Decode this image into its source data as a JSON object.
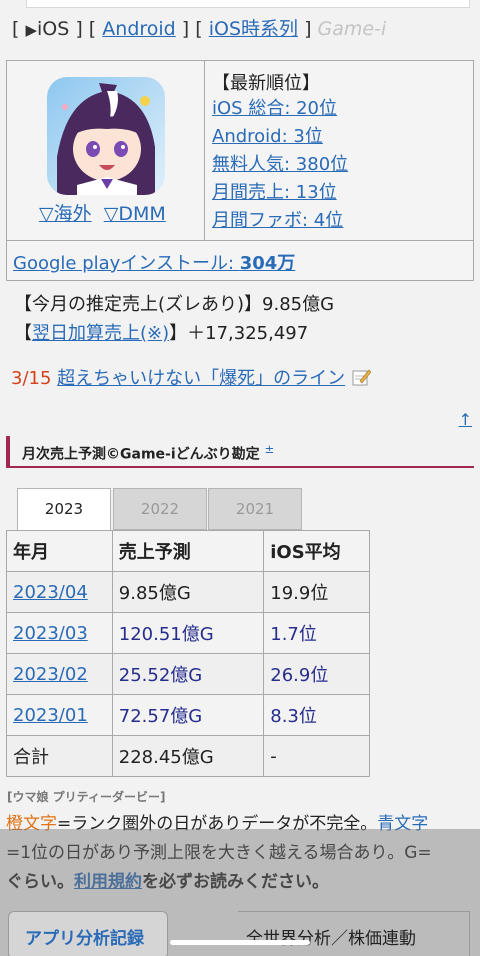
{
  "nav": {
    "open_bracket": "[",
    "ios_label": "iOS",
    "sep1": "] [",
    "android_label": "Android",
    "sep2": "] [",
    "timeline_label": "iOS時系列",
    "close_bracket": "]",
    "site_label": "Game-i"
  },
  "app": {
    "region_overseas": "▽海外",
    "region_dmm": "▽DMM",
    "ranking_title": "【最新順位】",
    "rankings": [
      "iOS 総合: 20位",
      "Android: 3位",
      "無料人気: 380位",
      "月間売上: 13位",
      "月間ファボ: 4位"
    ],
    "install_prefix": "Google playインストール: ",
    "install_count": "304万"
  },
  "estimates": {
    "monthly_label": "【今月の推定売上(ズレあり)】9.85億G",
    "daily_open": "【",
    "daily_link": "翌日加算売上(※)",
    "daily_close": "】＋17,325,497"
  },
  "warning": {
    "date": "3/15",
    "text": "超えちゃいけない「爆死」のライン",
    "icon": "memo-icon"
  },
  "section": {
    "title": "月次売上予測©Game-iどんぶり勘定",
    "sup": "±",
    "up_arrow": "↑"
  },
  "tabs": [
    "2023",
    "2022",
    "2021"
  ],
  "table": {
    "headers": [
      "年月",
      "売上予測",
      "iOS平均"
    ],
    "rows": [
      {
        "month": "2023/04",
        "sales": "9.85億G",
        "avg": "19.9位"
      },
      {
        "month": "2023/03",
        "sales": "120.51億G",
        "avg": "1.7位"
      },
      {
        "month": "2023/02",
        "sales": "25.52億G",
        "avg": "26.9位"
      },
      {
        "month": "2023/01",
        "sales": "72.57億G",
        "avg": "8.3位"
      }
    ],
    "total_label": "合計",
    "total_sales": "228.45億G",
    "total_avg": "-"
  },
  "note": {
    "game_label": "[ウマ娘 プリティーダービー]",
    "orange_word": "橙文字",
    "line1_rest": "=ランク圏外の日がありデータが不完全。",
    "blue_word": "青文字",
    "line2": "=1位の日があり予測上限を大きく越える場合あり。G=",
    "line3_pre": "ぐらい。",
    "terms_link": "利用規約",
    "line3_post": "を必ずお読みください。"
  },
  "footer": {
    "analysis_button": "アプリ分析記録",
    "side_text": "全世界分析／株価連動"
  },
  "colors": {
    "link": "#2a6bb8",
    "warning_date": "#d2431e",
    "section_accent": "#a12850",
    "orange_text": "#e07214",
    "navy_value": "#262d8c"
  }
}
